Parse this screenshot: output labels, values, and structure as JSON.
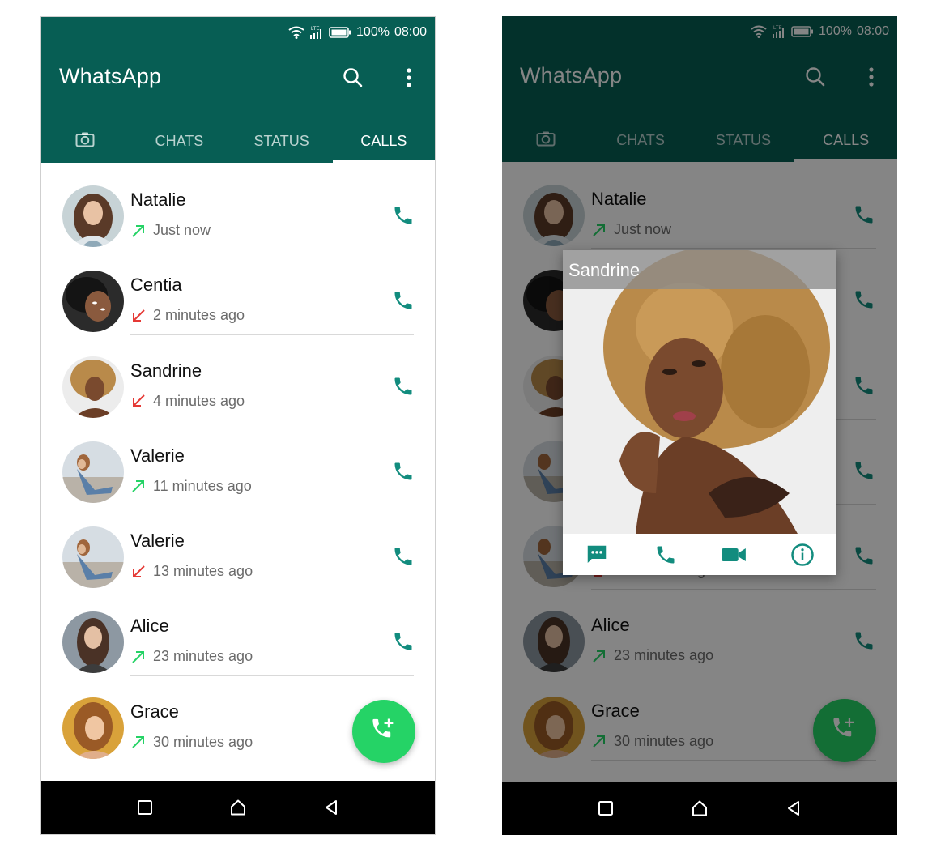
{
  "status_bar": {
    "network": "LTE",
    "battery": "100%",
    "time": "08:00"
  },
  "app": {
    "title": "WhatsApp"
  },
  "tabs": [
    {
      "label": "",
      "icon": "camera-icon"
    },
    {
      "label": "CHATS"
    },
    {
      "label": "STATUS"
    },
    {
      "label": "CALLS",
      "active": true
    }
  ],
  "calls": [
    {
      "name": "Natalie",
      "time": "Just now",
      "direction": "outgoing"
    },
    {
      "name": "Centia",
      "time": "2 minutes ago",
      "direction": "missed"
    },
    {
      "name": "Sandrine",
      "time": "4 minutes ago",
      "direction": "missed"
    },
    {
      "name": "Valerie",
      "time": "11 minutes ago",
      "direction": "outgoing"
    },
    {
      "name": "Valerie",
      "time": "13 minutes ago",
      "direction": "missed"
    },
    {
      "name": "Alice",
      "time": "23 minutes ago",
      "direction": "outgoing"
    },
    {
      "name": "Grace",
      "time": "30 minutes ago",
      "direction": "outgoing"
    }
  ],
  "profile_popup": {
    "name": "Sandrine",
    "actions": [
      "message-icon",
      "phone-icon",
      "video-call-icon",
      "info-icon"
    ]
  },
  "colors": {
    "header": "#075e54",
    "accent": "#128c7e",
    "fab": "#25d366",
    "outgoing_arrow": "#25d366",
    "missed_arrow": "#e53935"
  }
}
